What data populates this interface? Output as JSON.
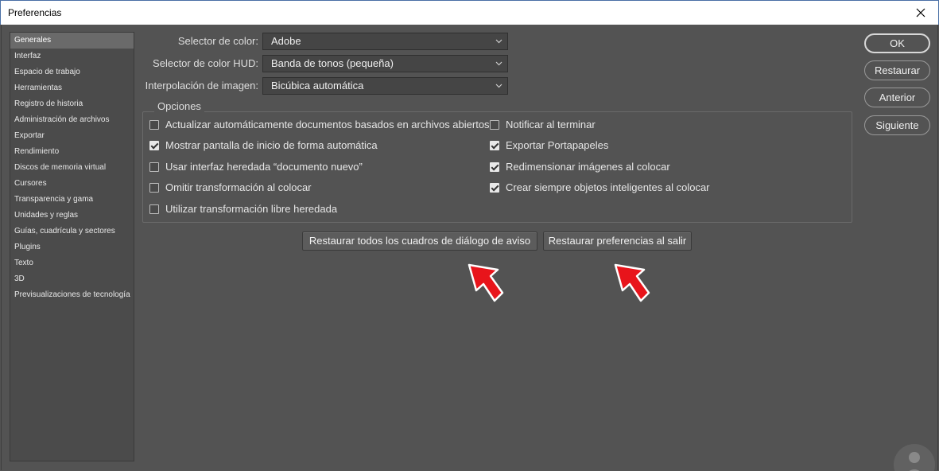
{
  "window": {
    "title": "Preferencias"
  },
  "sidebar": {
    "items": [
      {
        "label": "Generales",
        "active": true
      },
      {
        "label": "Interfaz"
      },
      {
        "label": "Espacio de trabajo"
      },
      {
        "label": "Herramientas"
      },
      {
        "label": "Registro de historia"
      },
      {
        "label": "Administración de archivos"
      },
      {
        "label": "Exportar"
      },
      {
        "label": "Rendimiento"
      },
      {
        "label": "Discos de memoria virtual"
      },
      {
        "label": "Cursores"
      },
      {
        "label": "Transparencia y gama"
      },
      {
        "label": "Unidades y reglas"
      },
      {
        "label": "Guías, cuadrícula y sectores"
      },
      {
        "label": "Plugins"
      },
      {
        "label": "Texto"
      },
      {
        "label": "3D"
      },
      {
        "label": "Previsualizaciones de tecnología"
      }
    ]
  },
  "fields": {
    "color_picker": {
      "label": "Selector de color:",
      "value": "Adobe"
    },
    "hud_color_picker": {
      "label": "Selector de color HUD:",
      "value": "Banda de tonos (pequeña)"
    },
    "interpolation": {
      "label": "Interpolación de imagen:",
      "value": "Bicúbica automática"
    }
  },
  "options": {
    "legend": "Opciones",
    "left": [
      {
        "label": "Actualizar automáticamente documentos basados en archivos abiertos",
        "checked": false
      },
      {
        "label": "Mostrar pantalla de inicio de forma automática",
        "checked": true
      },
      {
        "label": "Usar interfaz heredada “documento nuevo”",
        "checked": false
      },
      {
        "label": "Omitir transformación al colocar",
        "checked": false
      },
      {
        "label": "Utilizar transformación libre heredada",
        "checked": false
      }
    ],
    "right": [
      {
        "label": "Notificar al terminar",
        "checked": false
      },
      {
        "label": "Exportar Portapapeles",
        "checked": true
      },
      {
        "label": "Redimensionar imágenes al colocar",
        "checked": true
      },
      {
        "label": "Crear siempre objetos inteligentes al colocar",
        "checked": true
      }
    ]
  },
  "actions": {
    "reset_warnings": "Restaurar todos los cuadros de diálogo de aviso",
    "reset_prefs": "Restaurar preferencias al salir"
  },
  "buttons": {
    "ok": "OK",
    "restore": "Restaurar",
    "previous": "Anterior",
    "next": "Siguiente"
  },
  "colors": {
    "annotation_arrow": "#e8141b",
    "dialog_bg": "#535353"
  }
}
